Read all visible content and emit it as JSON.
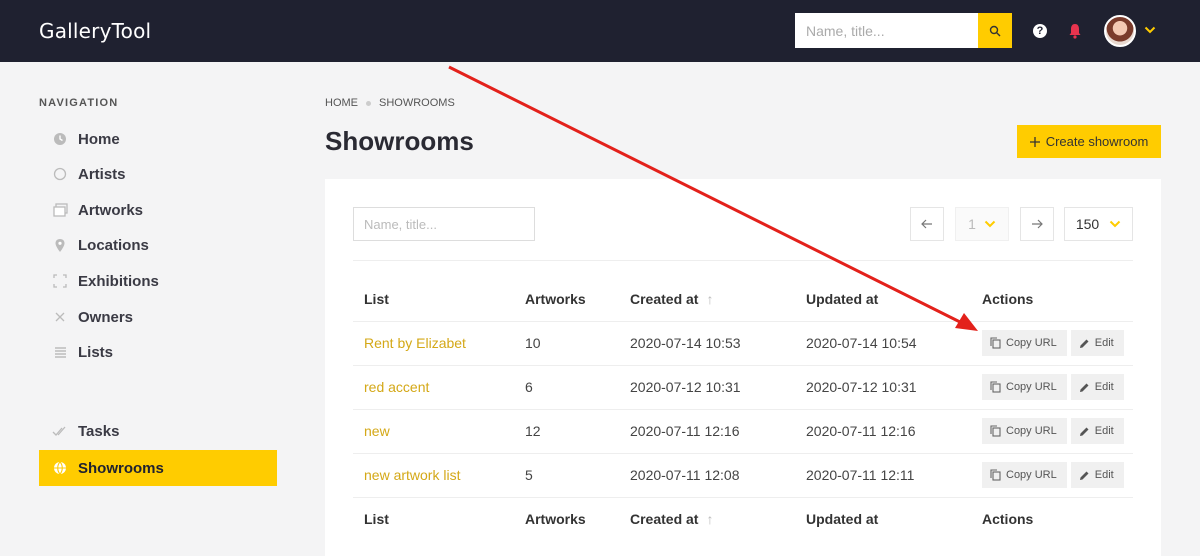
{
  "app": {
    "title": "GalleryTool"
  },
  "topbar": {
    "search_placeholder": "Name, title..."
  },
  "sidebar": {
    "section_title": "NAVIGATION",
    "items": [
      {
        "label": "Home",
        "icon": "clock-icon"
      },
      {
        "label": "Artists",
        "icon": "circle-icon"
      },
      {
        "label": "Artworks",
        "icon": "image-icon"
      },
      {
        "label": "Locations",
        "icon": "pin-icon"
      },
      {
        "label": "Exhibitions",
        "icon": "frame-icon"
      },
      {
        "label": "Owners",
        "icon": "x-icon"
      },
      {
        "label": "Lists",
        "icon": "list-icon"
      }
    ],
    "secondary": [
      {
        "label": "Tasks",
        "icon": "check-icon",
        "active": false
      },
      {
        "label": "Showrooms",
        "icon": "globe-icon",
        "active": true
      }
    ]
  },
  "breadcrumb": [
    "HOME",
    "SHOWROOMS"
  ],
  "page": {
    "title": "Showrooms",
    "create_label": "Create showroom"
  },
  "filter": {
    "placeholder": "Name, title..."
  },
  "pagination": {
    "page": "1",
    "per_page": "150"
  },
  "table": {
    "columns": [
      "List",
      "Artworks",
      "Created at",
      "Updated at",
      "Actions"
    ],
    "rows": [
      {
        "name": "Rent by Elizabet",
        "artworks": "10",
        "created": "2020-07-14 10:53",
        "updated": "2020-07-14 10:54"
      },
      {
        "name": "red accent",
        "artworks": "6",
        "created": "2020-07-12 10:31",
        "updated": "2020-07-12 10:31"
      },
      {
        "name": "new",
        "artworks": "12",
        "created": "2020-07-11 12:16",
        "updated": "2020-07-11 12:16"
      },
      {
        "name": "new artwork list",
        "artworks": "5",
        "created": "2020-07-11 12:08",
        "updated": "2020-07-11 12:11"
      }
    ],
    "actions": {
      "copy": "Copy URL",
      "edit": "Edit"
    }
  },
  "colors": {
    "accent": "#ffcc00",
    "topbar": "#1f2130",
    "link": "#d4a817",
    "annotation_arrow": "#e3211b"
  }
}
